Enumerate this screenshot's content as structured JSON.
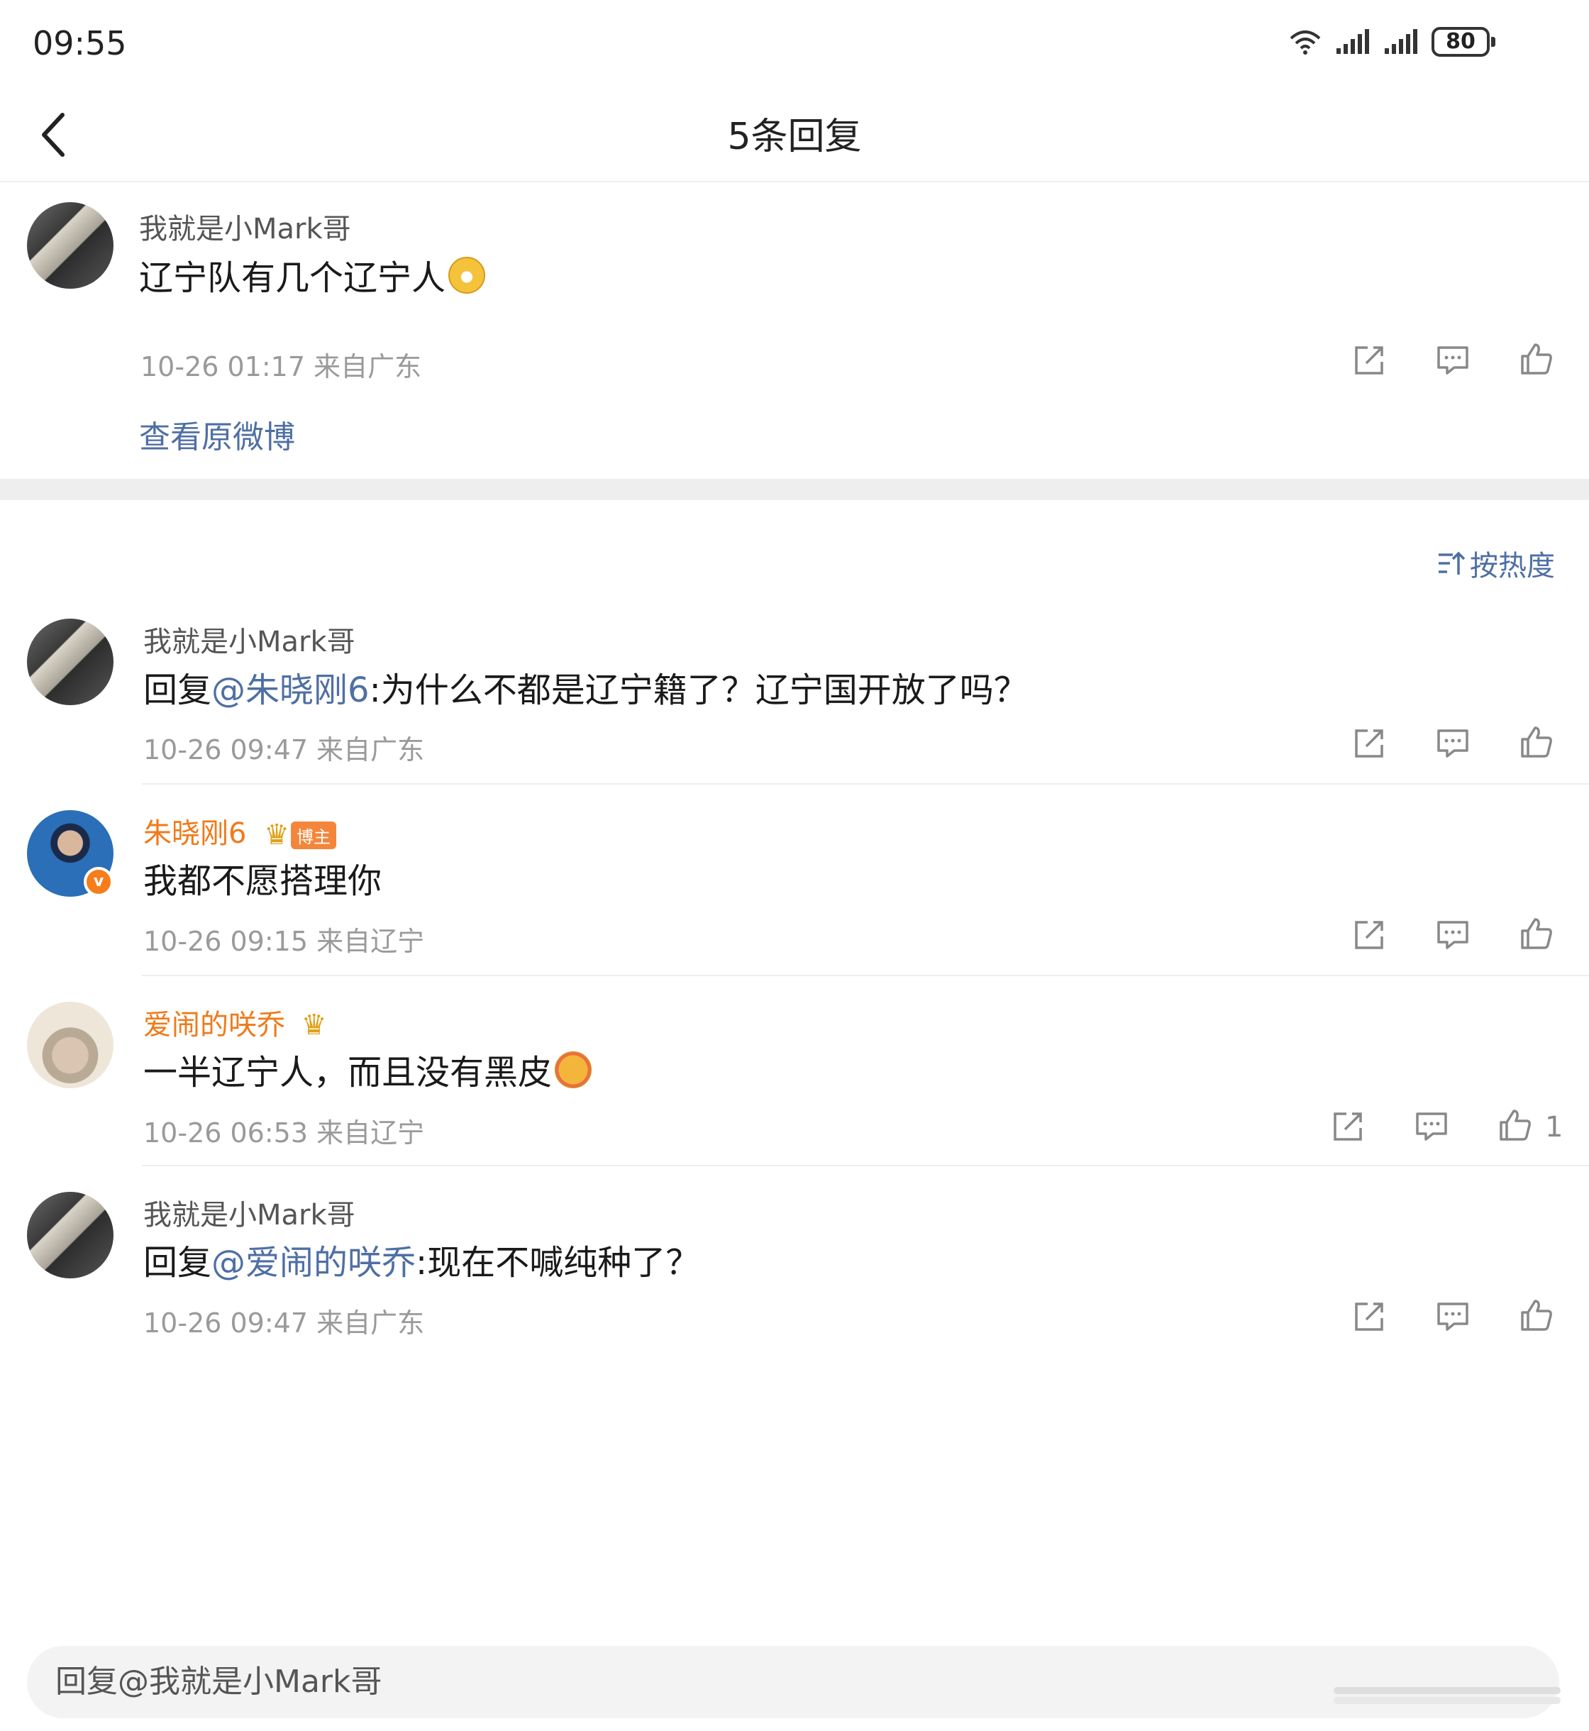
{
  "status": {
    "time": "09:55",
    "battery": "80"
  },
  "nav": {
    "title": "5条回复"
  },
  "root": {
    "username": "我就是小Mark哥",
    "content": "辽宁队有几个辽宁人",
    "time": "10-26 01:17",
    "location": "来自广东",
    "view_original": "查看原微博"
  },
  "sort": {
    "label": "按热度"
  },
  "replies": [
    {
      "username": "我就是小Mark哥",
      "prefix": "回复",
      "mention": "@朱晓刚6",
      "text": ":为什么不都是辽宁籍了？辽宁国开放了吗？",
      "time": "10-26 09:47",
      "location": "来自广东"
    },
    {
      "username": "朱晓刚6",
      "badge": "博主",
      "text": "我都不愿搭理你",
      "time": "10-26 09:15",
      "location": "来自辽宁"
    },
    {
      "username": "爱闹的咲乔",
      "text": "一半辽宁人，而且没有黑皮",
      "time": "10-26 06:53",
      "location": "来自辽宁",
      "likes": "1"
    },
    {
      "username": "我就是小Mark哥",
      "prefix": "回复",
      "mention": "@爱闹的咲乔",
      "text": ":现在不喊纯种了？",
      "time": "10-26 09:47",
      "location": "来自广东"
    }
  ],
  "reply_input": {
    "placeholder": "回复@我就是小Mark哥"
  },
  "icons": [
    "wifi-icon",
    "signal-icon",
    "battery-icon",
    "back-icon",
    "share-icon",
    "comment-icon",
    "like-icon",
    "sort-icon",
    "verified-icon",
    "crown-icon"
  ],
  "colors": {
    "accent": "#4f6fa4",
    "vip_name": "#ef7a1a",
    "meta": "#9a9a9a"
  }
}
